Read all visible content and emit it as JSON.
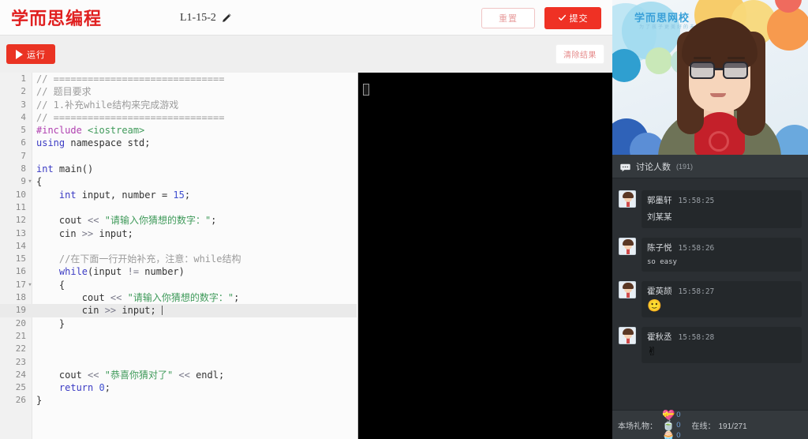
{
  "header": {
    "logo": "学而思编程",
    "doc_title": "L1-15-2",
    "pencil_icon": "pencil-icon",
    "reset_label": "重置",
    "submit_label": "提交",
    "check_icon": "check-icon"
  },
  "toolbar": {
    "run_label": "运行",
    "play_icon": "play-icon",
    "clear_label": "清除结果"
  },
  "editor": {
    "active_line": 19,
    "lines": [
      {
        "n": "1",
        "fold": "",
        "tokens": [
          {
            "t": "// ==============================",
            "c": "tok-cmt"
          }
        ]
      },
      {
        "n": "2",
        "fold": "",
        "tokens": [
          {
            "t": "// 题目要求",
            "c": "tok-cmt"
          }
        ]
      },
      {
        "n": "3",
        "fold": "",
        "tokens": [
          {
            "t": "// 1.补充while结构来完成游戏",
            "c": "tok-cmt"
          }
        ]
      },
      {
        "n": "4",
        "fold": "",
        "tokens": [
          {
            "t": "// ==============================",
            "c": "tok-cmt"
          }
        ]
      },
      {
        "n": "5",
        "fold": "",
        "tokens": [
          {
            "t": "#include ",
            "c": "tok-pre"
          },
          {
            "t": "<iostream>",
            "c": "tok-str"
          }
        ]
      },
      {
        "n": "6",
        "fold": "",
        "tokens": [
          {
            "t": "using ",
            "c": "tok-kw"
          },
          {
            "t": "namespace ",
            "c": "tok-plain"
          },
          {
            "t": "std;",
            "c": "tok-plain"
          }
        ]
      },
      {
        "n": "7",
        "fold": "",
        "tokens": []
      },
      {
        "n": "8",
        "fold": "",
        "tokens": [
          {
            "t": "int ",
            "c": "tok-kw"
          },
          {
            "t": "main()",
            "c": "tok-plain"
          }
        ]
      },
      {
        "n": "9",
        "fold": "▾",
        "tokens": [
          {
            "t": "{",
            "c": "tok-plain"
          }
        ]
      },
      {
        "n": "10",
        "fold": "",
        "tokens": [
          {
            "t": "    int ",
            "c": "tok-kw"
          },
          {
            "t": "input, number = ",
            "c": "tok-plain"
          },
          {
            "t": "15",
            "c": "tok-num"
          },
          {
            "t": ";",
            "c": "tok-plain"
          }
        ]
      },
      {
        "n": "11",
        "fold": "",
        "tokens": []
      },
      {
        "n": "12",
        "fold": "",
        "tokens": [
          {
            "t": "    cout ",
            "c": "tok-plain"
          },
          {
            "t": "<< ",
            "c": "tok-op"
          },
          {
            "t": "\"请输入你猜想的数字：\"",
            "c": "tok-str"
          },
          {
            "t": ";",
            "c": "tok-plain"
          }
        ]
      },
      {
        "n": "13",
        "fold": "",
        "tokens": [
          {
            "t": "    cin ",
            "c": "tok-plain"
          },
          {
            "t": ">> ",
            "c": "tok-op"
          },
          {
            "t": "input;",
            "c": "tok-plain"
          }
        ]
      },
      {
        "n": "14",
        "fold": "",
        "tokens": []
      },
      {
        "n": "15",
        "fold": "",
        "tokens": [
          {
            "t": "    //在下面一行开始补充，注意：while结构",
            "c": "tok-cmt"
          }
        ]
      },
      {
        "n": "16",
        "fold": "",
        "tokens": [
          {
            "t": "    while",
            "c": "tok-kw"
          },
          {
            "t": "(input ",
            "c": "tok-plain"
          },
          {
            "t": "!= ",
            "c": "tok-op"
          },
          {
            "t": "number)",
            "c": "tok-plain"
          }
        ]
      },
      {
        "n": "17",
        "fold": "▾",
        "tokens": [
          {
            "t": "    {",
            "c": "tok-plain"
          }
        ]
      },
      {
        "n": "18",
        "fold": "",
        "tokens": [
          {
            "t": "        cout ",
            "c": "tok-plain"
          },
          {
            "t": "<< ",
            "c": "tok-op"
          },
          {
            "t": "\"请输入你猜想的数字：\"",
            "c": "tok-str"
          },
          {
            "t": ";",
            "c": "tok-plain"
          }
        ]
      },
      {
        "n": "19",
        "fold": "",
        "tokens": [
          {
            "t": "        cin ",
            "c": "tok-plain"
          },
          {
            "t": ">> ",
            "c": "tok-op"
          },
          {
            "t": "input; ",
            "c": "tok-plain"
          }
        ],
        "caret": true
      },
      {
        "n": "20",
        "fold": "",
        "tokens": [
          {
            "t": "    }",
            "c": "tok-plain"
          }
        ]
      },
      {
        "n": "21",
        "fold": "",
        "tokens": []
      },
      {
        "n": "22",
        "fold": "",
        "tokens": []
      },
      {
        "n": "23",
        "fold": "",
        "tokens": []
      },
      {
        "n": "24",
        "fold": "",
        "tokens": [
          {
            "t": "    cout ",
            "c": "tok-plain"
          },
          {
            "t": "<< ",
            "c": "tok-op"
          },
          {
            "t": "\"恭喜你猜对了\"",
            "c": "tok-str"
          },
          {
            "t": " << ",
            "c": "tok-op"
          },
          {
            "t": "endl;",
            "c": "tok-plain"
          }
        ]
      },
      {
        "n": "25",
        "fold": "",
        "tokens": [
          {
            "t": "    return ",
            "c": "tok-kw"
          },
          {
            "t": "0",
            "c": "tok-num"
          },
          {
            "t": ";",
            "c": "tok-plain"
          }
        ]
      },
      {
        "n": "26",
        "fold": "",
        "tokens": [
          {
            "t": "}",
            "c": "tok-plain"
          }
        ]
      }
    ]
  },
  "console": {
    "caret_icon": "terminal-cursor-icon",
    "output": ""
  },
  "video": {
    "brand": "学而思网校",
    "brand_sub": "为了孩子更美好的未来"
  },
  "chat": {
    "icon": "chat-bubble-icon",
    "title": "讨论人数",
    "count": "(191)",
    "messages": [
      {
        "avatar": "user-avatar",
        "name": "郭墨轩",
        "time": "15:58:25",
        "text": "刘某某",
        "type": "text"
      },
      {
        "avatar": "user-avatar",
        "name": "陈子悦",
        "time": "15:58:26",
        "text": "so easy",
        "type": "mono"
      },
      {
        "avatar": "user-avatar",
        "name": "霍英颉",
        "time": "15:58:27",
        "text": "🙂",
        "type": "emoji"
      },
      {
        "avatar": "user-avatar",
        "name": "霍秋丞",
        "time": "15:58:28",
        "text": "✌",
        "type": "emoji"
      }
    ]
  },
  "footer": {
    "gift_label": "本场礼物：",
    "gifts": [
      {
        "icon": "heart-gift-icon",
        "glyph": "💝",
        "count": "0"
      },
      {
        "icon": "cup-gift-icon",
        "glyph": "🍵",
        "count": "0"
      },
      {
        "icon": "cake-gift-icon",
        "glyph": "🧁",
        "count": "0"
      }
    ],
    "online_label": "在线：",
    "online_value": "191/271"
  },
  "colors": {
    "brand_red": "#e02020",
    "submit_red": "#ef3124",
    "run_red": "#ea3323",
    "chat_bg": "#2b2f33",
    "console_bg": "#000000"
  }
}
